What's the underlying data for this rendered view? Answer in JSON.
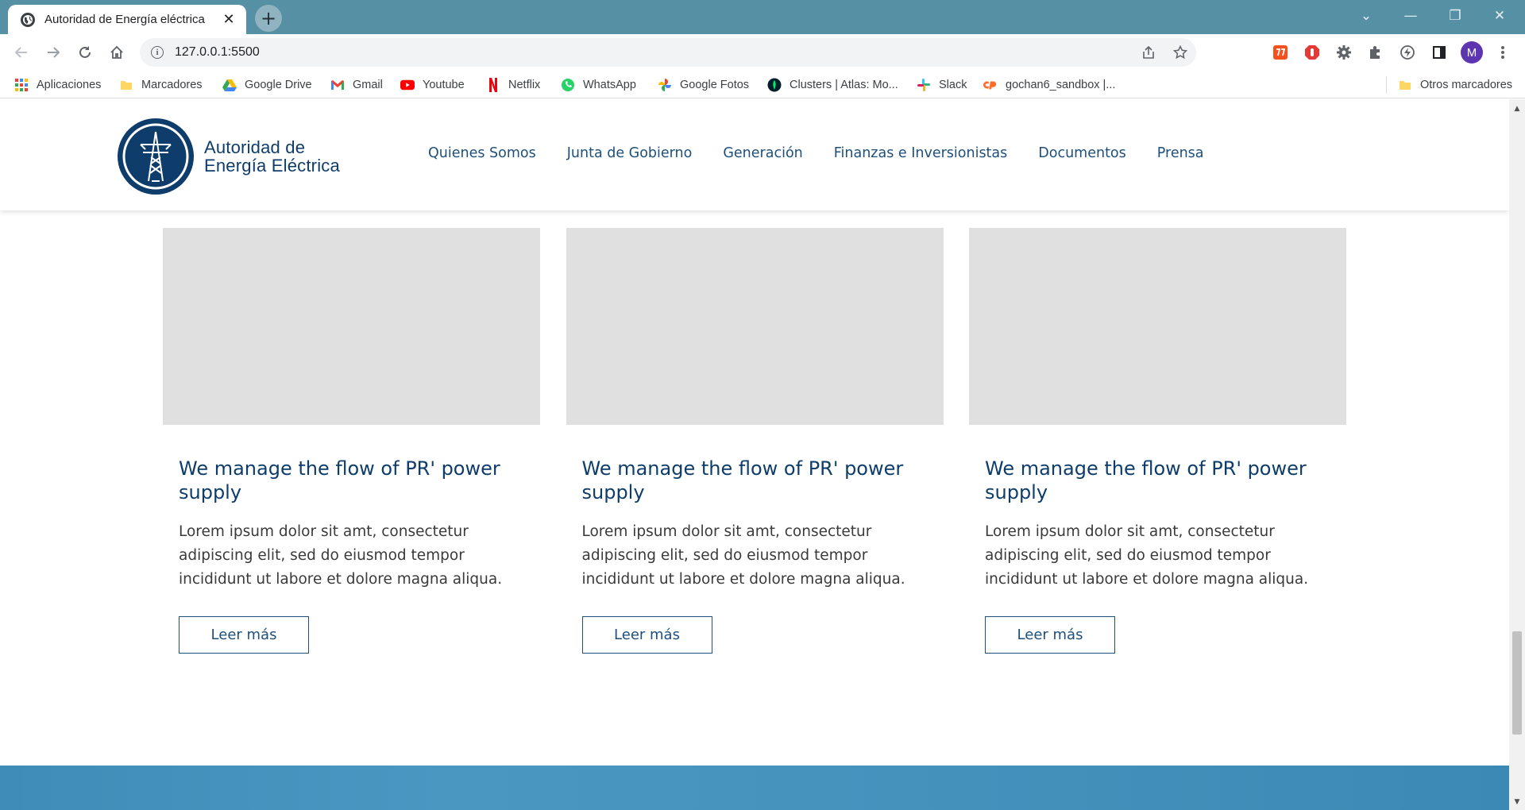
{
  "browser": {
    "tab_title": "Autoridad de Energía eléctrica",
    "tab_close": "✕",
    "new_tab": "+",
    "url": "127.0.0.1:5500",
    "window_controls": {
      "dropdown": "⌄",
      "minimize": "—",
      "restore": "❐",
      "close": "✕"
    }
  },
  "bookmarks": {
    "items": [
      {
        "label": "Aplicaciones",
        "icon": "apps-grid-icon"
      },
      {
        "label": "Marcadores",
        "icon": "folder-icon"
      },
      {
        "label": "Google Drive",
        "icon": "google-drive-icon"
      },
      {
        "label": "Gmail",
        "icon": "gmail-icon"
      },
      {
        "label": "Youtube",
        "icon": "youtube-icon"
      },
      {
        "label": "Netflix",
        "icon": "netflix-icon"
      },
      {
        "label": "WhatsApp",
        "icon": "whatsapp-icon"
      },
      {
        "label": "Google Fotos",
        "icon": "google-photos-icon"
      },
      {
        "label": "Clusters | Atlas: Mo...",
        "icon": "mongodb-icon"
      },
      {
        "label": "Slack",
        "icon": "slack-icon"
      },
      {
        "label": "gochan6_sandbox |...",
        "icon": "cpanel-icon"
      }
    ],
    "other": "Otros marcadores"
  },
  "site": {
    "logo_line1": "Autoridad de",
    "logo_line2": "Energía Eléctrica",
    "nav": [
      "Quienes Somos",
      "Junta de Gobierno",
      "Generación",
      "Finanzas e Inversionistas",
      "Documentos",
      "Prensa"
    ]
  },
  "cards": [
    {
      "title": "We manage the flow of PR' power supply",
      "text": "Lorem ipsum dolor sit amt, consectetur adipiscing elit, sed do eiusmod tempor incididunt ut labore et dolore magna aliqua.",
      "button": "Leer más"
    },
    {
      "title": "We manage the flow of PR' power supply",
      "text": "Lorem ipsum dolor sit amt, consectetur adipiscing elit, sed do eiusmod tempor incididunt ut labore et dolore magna aliqua.",
      "button": "Leer más"
    },
    {
      "title": "We manage the flow of PR' power supply",
      "text": "Lorem ipsum dolor sit amt, consectetur adipiscing elit, sed do eiusmod tempor incididunt ut labore et dolore magna aliqua.",
      "button": "Leer más"
    }
  ],
  "colors": {
    "tabstrip": "#5690a4",
    "brand_navy": "#0e3d6b",
    "nav_link": "#1e4f7a",
    "placeholder": "#e0e0e0",
    "footer": "#4592bd"
  },
  "avatar_letter": "M"
}
